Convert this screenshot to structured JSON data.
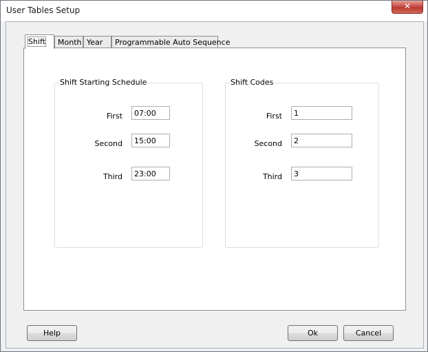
{
  "window": {
    "title": "User Tables Setup",
    "close_glyph": "✕"
  },
  "tabs": [
    {
      "label": "Shift",
      "active": true
    },
    {
      "label": "Month",
      "active": false
    },
    {
      "label": "Year",
      "active": false
    },
    {
      "label": "Programmable Auto Sequence",
      "active": false
    }
  ],
  "shift_schedule": {
    "caption": "Shift Starting Schedule",
    "rows": [
      {
        "label": "First",
        "value": "07:00"
      },
      {
        "label": "Second",
        "value": "15:00"
      },
      {
        "label": "Third",
        "value": "23:00"
      }
    ]
  },
  "shift_codes": {
    "caption": "Shift Codes",
    "rows": [
      {
        "label": "First",
        "value": "1"
      },
      {
        "label": "Second",
        "value": "2"
      },
      {
        "label": "Third",
        "value": "3"
      }
    ]
  },
  "buttons": {
    "help": "Help",
    "ok": "Ok",
    "cancel": "Cancel"
  }
}
